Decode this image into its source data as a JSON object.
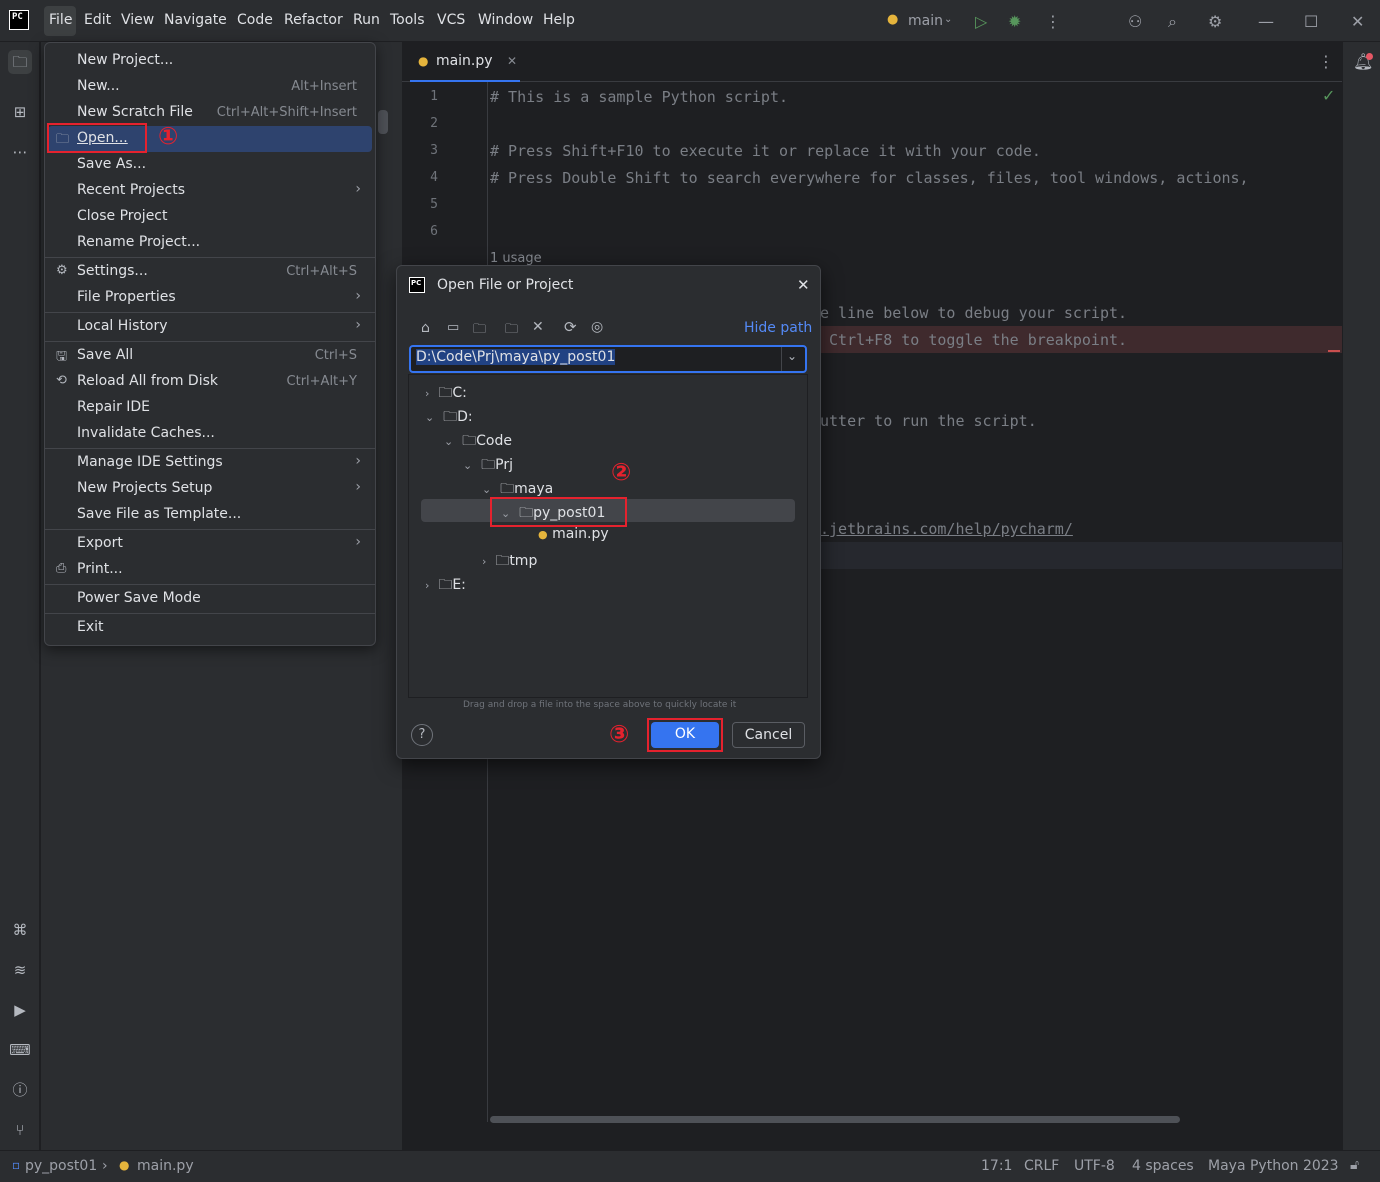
{
  "titlebar": {
    "logo": "PC",
    "menus": [
      "File",
      "Edit",
      "View",
      "Navigate",
      "Code",
      "Refactor",
      "Run",
      "Tools",
      "VCS",
      "Window",
      "Help"
    ],
    "branch": "main",
    "icons": [
      "run-icon",
      "debug-icon",
      "more-vert-icon",
      "add-user-icon",
      "search-icon",
      "settings-icon",
      "minimize-icon",
      "maximize-icon",
      "close-icon"
    ]
  },
  "editor": {
    "tab_label": "main.py",
    "line_numbers": [
      "1",
      "2",
      "3",
      "4",
      "5",
      "6"
    ],
    "lines": [
      "# This is a sample Python script.",
      "",
      "# Press Shift+F10 to execute it or replace it with your code.",
      "# Press Double Shift to search everywhere for classes, files, tool windows, actions,",
      "",
      ""
    ],
    "usage_hint": "1 usage",
    "visible_fragments": [
      "e line below to debug your script.",
      " Ctrl+F8 to toggle the breakpoint.",
      "utter to run the script.",
      ".jetbrains.com/help/pycharm/"
    ]
  },
  "file_menu": {
    "items": [
      {
        "label": "New Project...",
        "shortcut": ""
      },
      {
        "label": "New...",
        "shortcut": "Alt+Insert"
      },
      {
        "label": "New Scratch File",
        "shortcut": "Ctrl+Alt+Shift+Insert"
      },
      {
        "label": "Open...",
        "shortcut": ""
      },
      {
        "label": "Save As...",
        "shortcut": ""
      },
      {
        "label": "Recent Projects",
        "shortcut": ""
      },
      {
        "label": "Close Project",
        "shortcut": ""
      },
      {
        "label": "Rename Project...",
        "shortcut": ""
      },
      {
        "label": "Settings...",
        "shortcut": "Ctrl+Alt+S"
      },
      {
        "label": "File Properties",
        "shortcut": ""
      },
      {
        "label": "Local History",
        "shortcut": ""
      },
      {
        "label": "Save All",
        "shortcut": "Ctrl+S"
      },
      {
        "label": "Reload All from Disk",
        "shortcut": "Ctrl+Alt+Y"
      },
      {
        "label": "Repair IDE",
        "shortcut": ""
      },
      {
        "label": "Invalidate Caches...",
        "shortcut": ""
      },
      {
        "label": "Manage IDE Settings",
        "shortcut": ""
      },
      {
        "label": "New Projects Setup",
        "shortcut": ""
      },
      {
        "label": "Save File as Template...",
        "shortcut": ""
      },
      {
        "label": "Export",
        "shortcut": ""
      },
      {
        "label": "Print...",
        "shortcut": ""
      },
      {
        "label": "Power Save Mode",
        "shortcut": ""
      },
      {
        "label": "Exit",
        "shortcut": ""
      }
    ]
  },
  "annotations": {
    "step1": "①",
    "step2": "②",
    "step3": "③"
  },
  "dialog": {
    "title": "Open File or Project",
    "hide_path": "Hide path",
    "path_value": "D:\\Code\\Prj\\maya\\py_post01",
    "tree": {
      "c": "C:",
      "d": "D:",
      "code": "Code",
      "prj": "Prj",
      "maya": "maya",
      "py_post01": "py_post01",
      "main_py": "main.py",
      "tmp": "tmp",
      "e": "E:"
    },
    "hint": "Drag and drop a file into the space above to quickly locate it",
    "help": "?",
    "ok": "OK",
    "cancel": "Cancel"
  },
  "statusbar": {
    "project": "py_post01",
    "file": "main.py",
    "position": "17:1",
    "line_sep": "CRLF",
    "encoding": "UTF-8",
    "indent": "4 spaces",
    "interpreter": "Maya Python 2023"
  }
}
